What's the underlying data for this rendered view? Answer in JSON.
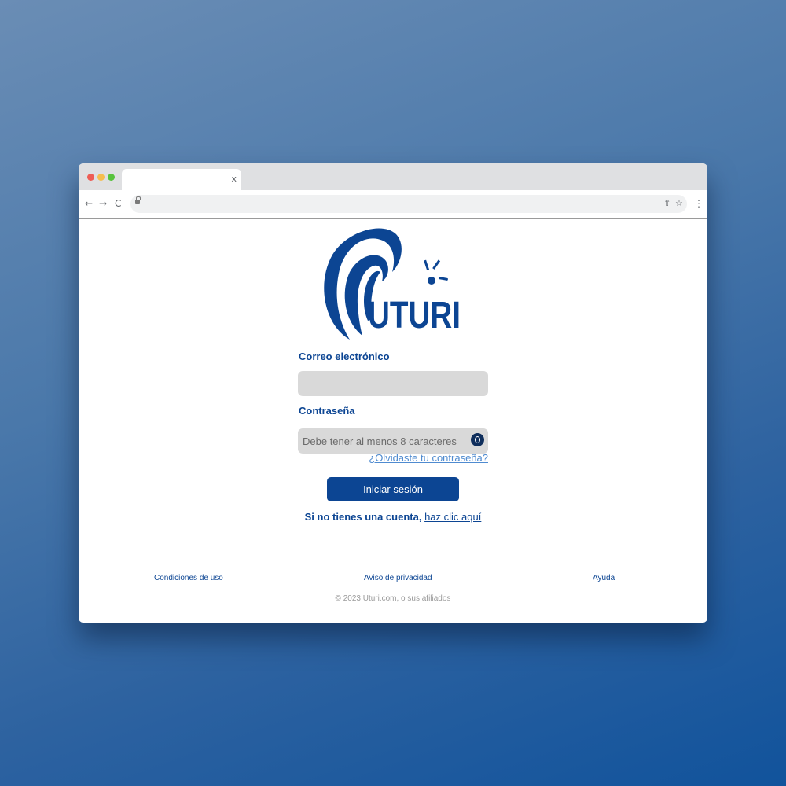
{
  "browser": {
    "tab_close": "x",
    "nav_back": "←",
    "nav_forward": "→",
    "nav_reload": "C",
    "icons": [
      "back-arrow-icon",
      "forward-arrow-icon",
      "reload-icon",
      "lock-icon",
      "share-icon",
      "star-icon",
      "kebab-menu-icon"
    ],
    "share_icon": "⇧",
    "star_icon": "☆",
    "menu_icon": "⋮"
  },
  "brand": {
    "name": "UTURI",
    "primary_color": "#0c4593",
    "link_color": "#4f8bd0"
  },
  "form": {
    "email_label": "Correo electrónico",
    "email_value": "",
    "password_label": "Contraseña",
    "password_placeholder": "Debe tener al menos 8 caracteres",
    "forgot_link": "¿Olvidaste tu contraseña?",
    "submit_label": "Iniciar sesión",
    "register_prompt": "Si no tienes una cuenta,",
    "register_link": "haz clic aquí"
  },
  "footer": {
    "terms": "Condiciones de uso",
    "privacy": "Aviso de privacidad",
    "help": "Ayuda",
    "copyright": "© 2023 Uturi.com, o sus afiliados"
  }
}
